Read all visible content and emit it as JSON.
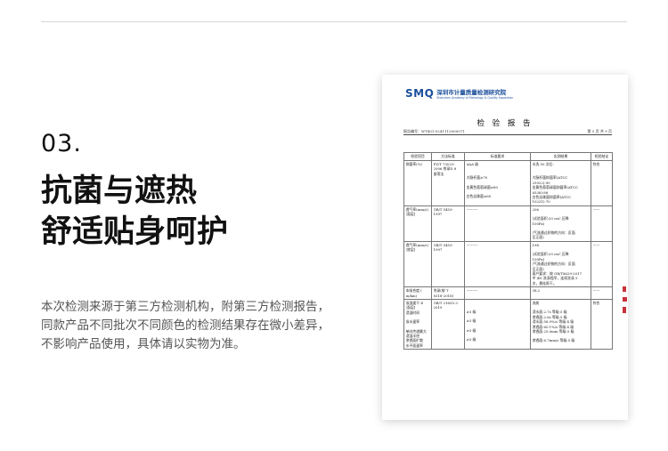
{
  "section_number": "03.",
  "headline": [
    "抗菌与遮热",
    "舒适贴身呵护"
  ],
  "notice": [
    "本次检测来源于第三方检测机构，附第三方检测报告，",
    "同款产品不同批次不同颜色的检测结果存在微小差异，",
    "不影响产品使用，具体请以实物为准。"
  ],
  "report": {
    "logo_mark": "SMQ",
    "logo_cn": "深圳市计量质量检测研究院",
    "logo_en": "Shenzhen Academy of Metrology & Quality Inspection",
    "title": "检 验 报 告",
    "report_no": "报告编号：WT401-0241113000071",
    "page_no": "第 5 页 共 9 页",
    "columns": [
      "检验项目",
      "方法标准",
      "标准要求",
      "实测结果",
      "检验结论"
    ],
    "rows": [
      {
        "item": [
          "抑菌率(%)"
        ],
        "method": [
          "FZ/T 73023-",
          "2006 附录D 8",
          "振荡法"
        ],
        "requirement": [
          "AAA 级",
          "",
          "",
          "大肠杆菌≥70",
          "",
          "金黄色葡萄球菌≥80",
          "",
          "白色念珠菌≥60"
        ],
        "result": [
          "水洗 50 次后:",
          "",
          "",
          "大肠杆菌抑菌率(ATCC",
          "25922):90",
          "金黄色葡萄球菌抑菌率(ATCC",
          "6538):88",
          "白色念珠菌抑菌率(ATCC",
          "10231):70"
        ],
        "conclusion": [
          "符合"
        ]
      },
      {
        "item": [
          "透气率(mm/s)",
          "[面层]"
        ],
        "method": [
          "GB/T 5453-",
          "1997"
        ],
        "requirement": [
          "----------"
        ],
        "result": [
          "206",
          "",
          "(试验面积:20 cm²,压降",
          "100Pa)",
          "",
          "(气流通过织物的方向：反面",
          "至正面)"
        ],
        "conclusion": [
          "------"
        ]
      },
      {
        "item": [
          "透气率(mm/s)",
          "[底层]"
        ],
        "method": [
          "GB/T 5453-",
          "1997"
        ],
        "requirement": [
          "----------"
        ],
        "result": [
          "198",
          "",
          "(试验面积:20 cm²,压降",
          "100Pa)",
          "(气流通过织物的方向：反面",
          "至正面)",
          "客户要求：按 GB/T8629-2017",
          "中 4N 洗涤程序，连续洗涤 5",
          "次，悬挂晾干。"
        ],
        "conclusion": [
          "------"
        ]
      },
      {
        "item": [
          "本吸合度 (",
          "m/km)"
        ],
        "method": [
          "附录(按 T",
          "8318-2018)"
        ],
        "requirement": [
          "----------"
        ],
        "result": [
          "38.2"
        ],
        "conclusion": [
          "------"
        ]
      },
      {
        "item": [
          "吸湿速干 Ⅱ",
          "[面层]",
          "  浸湿时间",
          "",
          "  吸水速率",
          "",
          "  单向传递最大",
          "浸湿半径",
          "  渗透面扩散",
          "水平面速率"
        ],
        "method": [
          "GB/T 21655.2-",
          "2019"
        ],
        "requirement": [
          "",
          "",
          "≥3 级",
          "",
          "≥3 级",
          "",
          "≥3 级",
          "",
          "≥3 级"
        ],
        "result": [
          "洗前",
          "",
          "浸水面:2.7s    等级:5 级",
          "渗透面:2.6s    等级:5 级",
          "浸水面:58.9%/s  等级:4 级",
          "渗透面:60.1%/s  等级:4 级",
          "渗透面:25.0mm  等级:5 级",
          "",
          "渗透面:6.7mm/s  等级:5 级"
        ],
        "conclusion": [
          "符合"
        ]
      }
    ]
  }
}
